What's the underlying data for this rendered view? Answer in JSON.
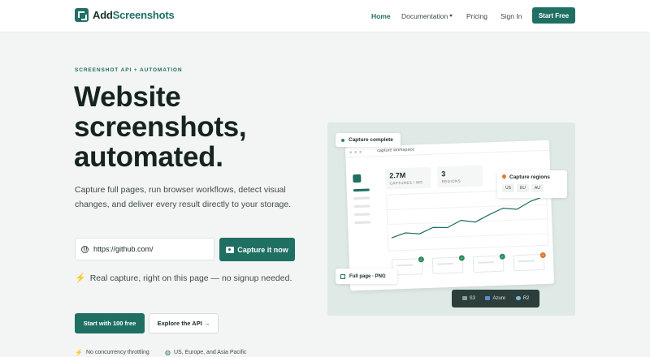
{
  "brand": {
    "name_part1": "Add",
    "name_part2": "Screenshots"
  },
  "nav": {
    "home": "Home",
    "documentation": "Documentation",
    "pricing": "Pricing",
    "signin": "Sign In",
    "start_free": "Start Free"
  },
  "hero": {
    "eyebrow": "SCREENSHOT API + AUTOMATION",
    "headline_line1": "Website",
    "headline_line2": "screenshots,",
    "headline_line3": "automated.",
    "subtitle": "Capture full pages, run browser workflows, detect visual changes, and deliver every result directly to your storage.",
    "url_value": "https://github.com/",
    "capture_button": "Capture it now",
    "note": "Real capture, right on this page — no signup needed.",
    "start_100": "Start with 100 free",
    "explore_api": "Explore the API",
    "explore_arrow": "→"
  },
  "footer_features": {
    "feature1": "No concurrency throttling",
    "feature2": "US, Europe, and Asia Pacific"
  },
  "mockup": {
    "status_card": "Capture complete",
    "window_title": "capture workspace",
    "stat1_value": "2.7M",
    "stat1_label": "CAPTURES / MO",
    "stat2_value": "3",
    "stat2_label": "REGIONS",
    "regions_title": "Capture regions",
    "regions": [
      "US",
      "EU",
      "AU"
    ],
    "full_page": "Full page · PNG",
    "storage": [
      "S3",
      "Azure",
      "R2"
    ]
  },
  "chart_data": {
    "type": "line",
    "title": "",
    "xlabel": "",
    "ylabel": "",
    "series": [
      {
        "values": [
          10,
          16,
          14,
          22,
          21,
          30,
          27,
          36,
          44,
          42,
          52,
          58
        ]
      }
    ]
  },
  "colors": {
    "brand": "#1f6f63",
    "accent_orange": "#e07a2f",
    "success": "#2d8a5d",
    "dark_bar": "#2c3e3b"
  }
}
